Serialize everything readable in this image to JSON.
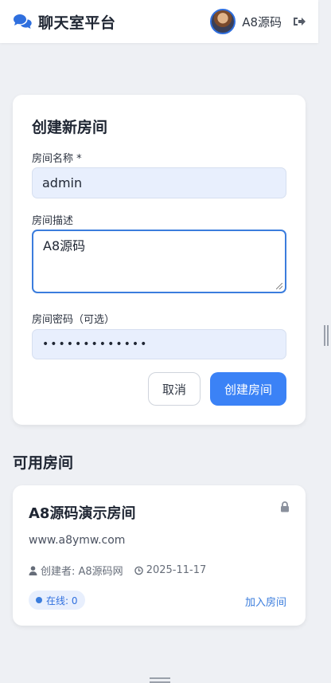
{
  "navbar": {
    "brand_title": "聊天室平台",
    "brand_icon": "comments-icon",
    "username": "A8源码",
    "logout_icon": "sign-out-icon"
  },
  "create_room": {
    "title": "创建新房间",
    "name_label": "房间名称 *",
    "name_value": "admin",
    "desc_label": "房间描述",
    "desc_value": "A8源码",
    "password_label": "房间密码（可选）",
    "password_value": "•••••••••••••",
    "cancel_label": "取消",
    "submit_label": "创建房间"
  },
  "rooms_section": {
    "title": "可用房间",
    "rooms": [
      {
        "name": "A8源码演示房间",
        "description": "www.a8ymw.com",
        "creator": "创建者: A8源码网",
        "date": "2025-11-17",
        "online": "在线: 0",
        "join_label": "加入房间",
        "locked": true
      }
    ]
  },
  "colors": {
    "accent": "#3b82f6",
    "input_bg": "#e8effd",
    "page_bg": "#eef0f4"
  }
}
